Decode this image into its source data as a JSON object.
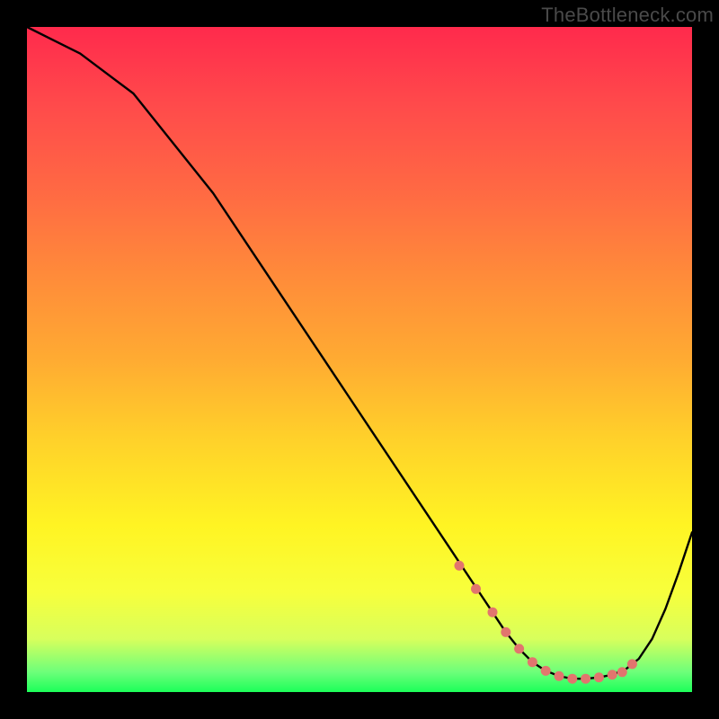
{
  "watermark": "TheBottleneck.com",
  "colors": {
    "page_bg": "#000000",
    "gradient_top": "#ff2a4c",
    "gradient_mid1": "#ffab32",
    "gradient_mid2": "#fff423",
    "gradient_bottom": "#1cff59",
    "curve_stroke": "#000000",
    "dot_fill": "#e2756e",
    "watermark_text": "#4a4a4a"
  },
  "chart_data": {
    "type": "line",
    "title": "",
    "xlabel": "",
    "ylabel": "",
    "xlim": [
      0,
      100
    ],
    "ylim": [
      0,
      100
    ],
    "grid": false,
    "legend": false,
    "series": [
      {
        "name": "bottleneck-curve",
        "x": [
          0,
          4,
          8,
          12,
          16,
          20,
          24,
          28,
          32,
          36,
          40,
          44,
          48,
          52,
          56,
          60,
          64,
          66,
          68,
          70,
          72,
          74,
          76,
          78,
          80,
          82,
          84,
          86,
          88,
          90,
          92,
          94,
          96,
          98,
          100
        ],
        "y": [
          100,
          98,
          96,
          93,
          90,
          85,
          80,
          75,
          69,
          63,
          57,
          51,
          45,
          39,
          33,
          27,
          21,
          18,
          15,
          12,
          9,
          6.5,
          4.5,
          3.2,
          2.4,
          2.0,
          2.0,
          2.2,
          2.6,
          3.4,
          5.0,
          8.0,
          12.5,
          18.0,
          24.0
        ]
      }
    ],
    "markers": {
      "name": "curve-dots",
      "x": [
        65,
        67.5,
        70,
        72,
        74,
        76,
        78,
        80,
        82,
        84,
        86,
        88,
        89.5,
        91
      ],
      "y": [
        19,
        15.5,
        12,
        9,
        6.5,
        4.5,
        3.2,
        2.4,
        2.0,
        2.0,
        2.2,
        2.6,
        3.0,
        4.2
      ]
    }
  }
}
